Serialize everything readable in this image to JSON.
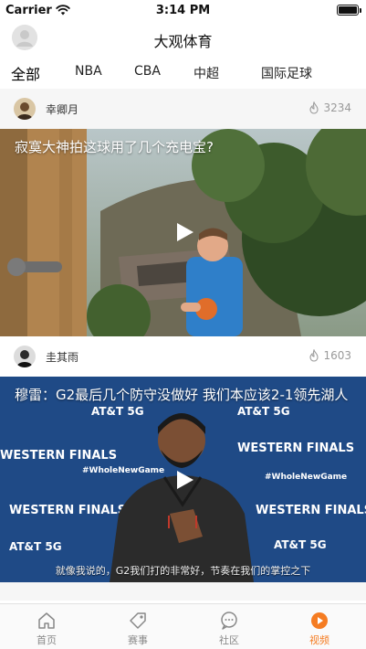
{
  "status_bar": {
    "carrier": "Carrier",
    "time": "3:14 PM"
  },
  "nav": {
    "title": "大观体育"
  },
  "tabs": [
    {
      "label": "全部",
      "active": true
    },
    {
      "label": "NBA"
    },
    {
      "label": "CBA"
    },
    {
      "label": "中超"
    },
    {
      "label": "国际足球"
    }
  ],
  "feed": [
    {
      "author": "幸卿月",
      "likes": "3234",
      "title": "寂寞大神拍这球用了几个充电宝?"
    },
    {
      "author": "圭其雨",
      "likes": "1603",
      "title": "穆雷：G2最后几个防守没做好 我们本应该2-1领先湖人",
      "subtitle": "就像我说的，G2我们打的非常好，节奏在我们的掌控之下",
      "banner_words": [
        "AT&T 5G",
        "WESTERN FINALS",
        "#WholeNewGame"
      ]
    }
  ],
  "tabbar": [
    {
      "label": "首页",
      "icon": "home-icon"
    },
    {
      "label": "赛事",
      "icon": "tag-icon"
    },
    {
      "label": "社区",
      "icon": "chat-icon"
    },
    {
      "label": "视频",
      "icon": "video-icon",
      "active": true
    }
  ],
  "colors": {
    "accent": "#f57c22",
    "backdrop": "#1f4a86"
  }
}
